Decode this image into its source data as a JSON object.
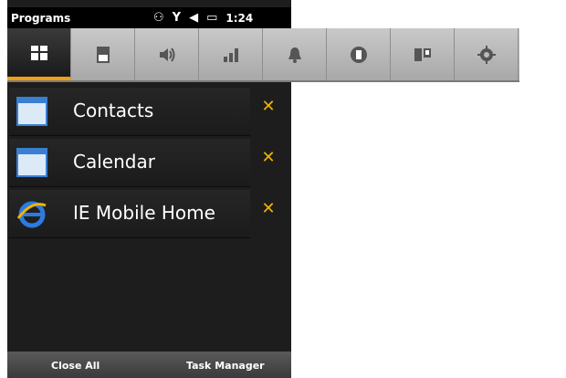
{
  "statusbar": {
    "title": "Programs",
    "time": "1:24",
    "icons": [
      "connectivity-icon",
      "signal-icon",
      "speaker-icon",
      "battery-icon"
    ]
  },
  "tabs": [
    {
      "icon": "programs-icon",
      "active": true
    },
    {
      "icon": "memory-card-icon",
      "active": false
    },
    {
      "icon": "sounds-icon",
      "active": false
    },
    {
      "icon": "signal-bars-icon",
      "active": false
    },
    {
      "icon": "bell-icon",
      "active": false
    },
    {
      "icon": "phone-icon",
      "active": false
    },
    {
      "icon": "devices-icon",
      "active": false
    },
    {
      "icon": "settings-gear-icon",
      "active": false
    }
  ],
  "running_programs": [
    {
      "label": "Contacts",
      "icon": "window-icon",
      "close": "✕"
    },
    {
      "label": "Calendar",
      "icon": "window-icon",
      "close": "✕"
    },
    {
      "label": "IE Mobile Home",
      "icon": "internet-explorer-icon",
      "close": "✕"
    }
  ],
  "softkeys": {
    "left": "Close All",
    "right": "Task Manager"
  },
  "colors": {
    "accent": "#f0a012",
    "close_x": "#f0b400",
    "panel_bg": "#1d1d1d"
  }
}
